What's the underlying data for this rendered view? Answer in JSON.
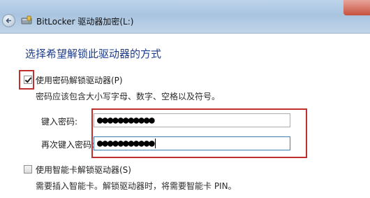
{
  "window": {
    "title": "BitLocker 驱动器加密(L:)"
  },
  "page": {
    "heading": "选择希望解锁此驱动器的方式"
  },
  "password_option": {
    "label": "使用密码解锁驱动器(P)",
    "checked": true,
    "hint": "密码应该包含大小写字母、数字、空格以及符号。",
    "enter_label": "键入密码:",
    "enter_value": "●●●●●●●●●●●",
    "reenter_label": "再次键入密码:",
    "reenter_value": "●●●●●●●●●●●"
  },
  "smartcard_option": {
    "label": "使用智能卡解锁驱动器(S)",
    "checked": false,
    "hint": "需要插入智能卡。解锁驱动器时，将需要智能卡 PIN。"
  },
  "colors": {
    "heading": "#1f3d8a",
    "highlight": "#c0302f"
  },
  "icons": {
    "back": "back-arrow-icon",
    "app": "bitlocker-drive-icon"
  }
}
